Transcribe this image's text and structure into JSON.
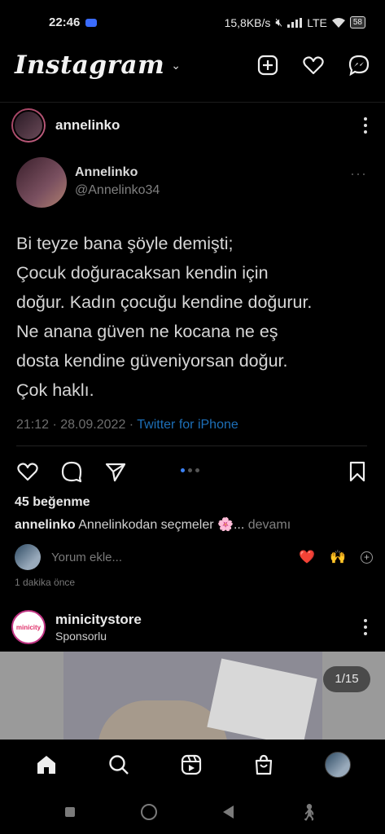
{
  "status": {
    "time": "22:46",
    "net_speed": "15,8KB/s",
    "network": "LTE",
    "battery": "58"
  },
  "header": {
    "logo": "Instagram",
    "chevron": "⌄"
  },
  "post": {
    "username": "annelinko",
    "tweet": {
      "name": "Annelinko",
      "handle": "@Annelinko34",
      "dots": "···",
      "lines": [
        "Bi teyze bana şöyle demişti;",
        "Çocuk doğuracaksan kendin için",
        "doğur. Kadın çocuğu kendine doğurur.",
        "Ne anana güven ne kocana ne eş",
        "dosta kendine güveniyorsan doğur.",
        "Çok haklı."
      ],
      "meta": "21:12 · 28.09.2022 · ",
      "source": "Twitter for iPhone"
    },
    "likes": "45 beğenme",
    "caption_user": "annelinko",
    "caption_text": " Annelinkodan seçmeler 🌸...",
    "caption_more": " devamı",
    "comment_placeholder": "Yorum ekle...",
    "comment_emojis": [
      "❤️",
      "🙌"
    ],
    "comment_plus": "+",
    "time_ago": "1 dakika önce"
  },
  "ad": {
    "username": "minicitystore",
    "sub": "Sponsorlu",
    "logo_text": "minicity",
    "counter": "1/15"
  },
  "colors": {
    "accent": "#3b82f6",
    "link": "#1d6fb8",
    "background": "#000000"
  }
}
